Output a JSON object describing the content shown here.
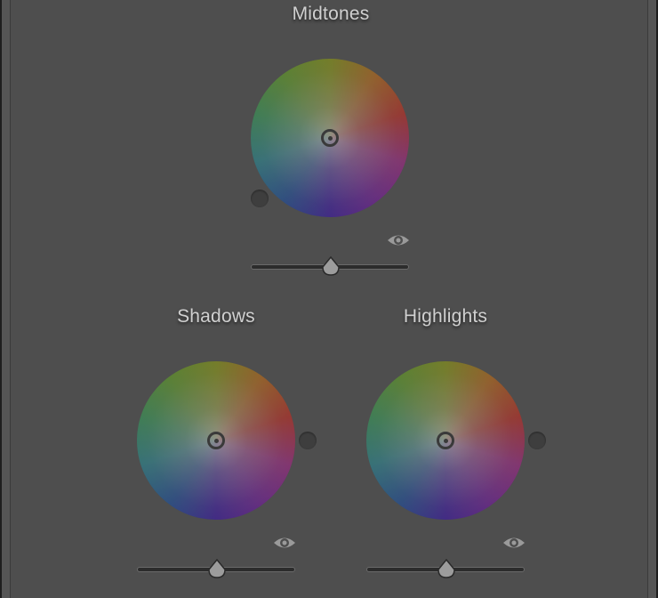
{
  "wheels": {
    "midtones": {
      "title": "Midtones",
      "slider_value": 0.5
    },
    "shadows": {
      "title": "Shadows",
      "slider_value": 0.5
    },
    "highlights": {
      "title": "Highlights",
      "slider_value": 0.5
    }
  },
  "icons": {
    "visibility": "eye-icon",
    "target": "target-icon",
    "slider_thumb": "slider-thumb"
  },
  "colors": {
    "panel_background": "#4e4e4e",
    "label_text": "#d0d0d0"
  }
}
